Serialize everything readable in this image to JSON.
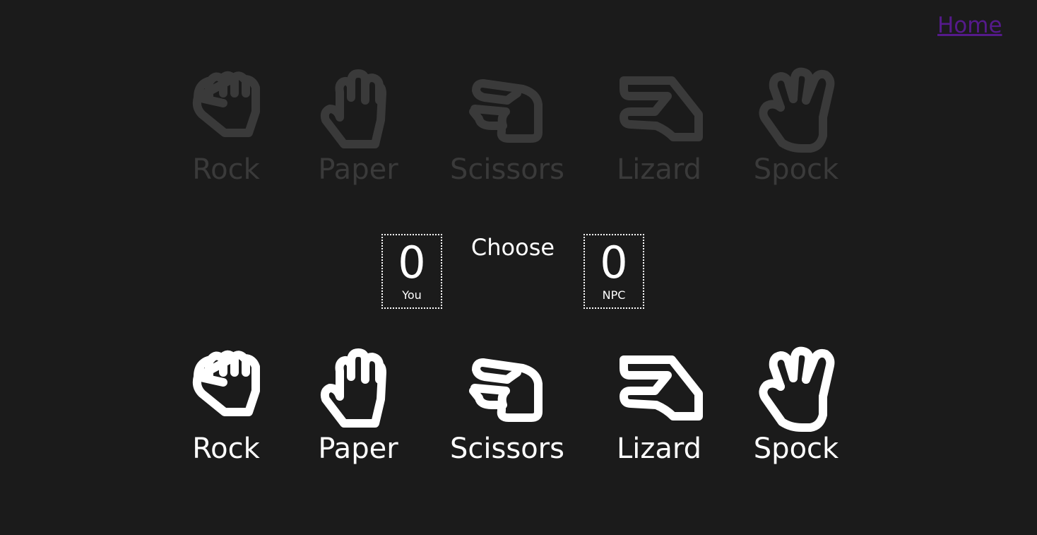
{
  "nav": {
    "home_label": "Home"
  },
  "status": "Choose",
  "scoreboard": {
    "player": {
      "score": "0",
      "label": "You"
    },
    "npc": {
      "score": "0",
      "label": "NPC"
    }
  },
  "npc_hands": [
    {
      "label": "Rock",
      "icon": "fist-icon"
    },
    {
      "label": "Paper",
      "icon": "open-hand-icon"
    },
    {
      "label": "Scissors",
      "icon": "scissors-hand-icon"
    },
    {
      "label": "Lizard",
      "icon": "lizard-hand-icon"
    },
    {
      "label": "Spock",
      "icon": "vulcan-salute-icon"
    }
  ],
  "player_hands": [
    {
      "label": "Rock",
      "icon": "fist-icon"
    },
    {
      "label": "Paper",
      "icon": "open-hand-icon"
    },
    {
      "label": "Scissors",
      "icon": "scissors-hand-icon"
    },
    {
      "label": "Lizard",
      "icon": "lizard-hand-icon"
    },
    {
      "label": "Spock",
      "icon": "vulcan-salute-icon"
    }
  ],
  "colors": {
    "background": "#1b1b1b",
    "inactive_hand": "#3a3a3a",
    "active_hand": "#ffffff",
    "link": "#551a8b"
  }
}
